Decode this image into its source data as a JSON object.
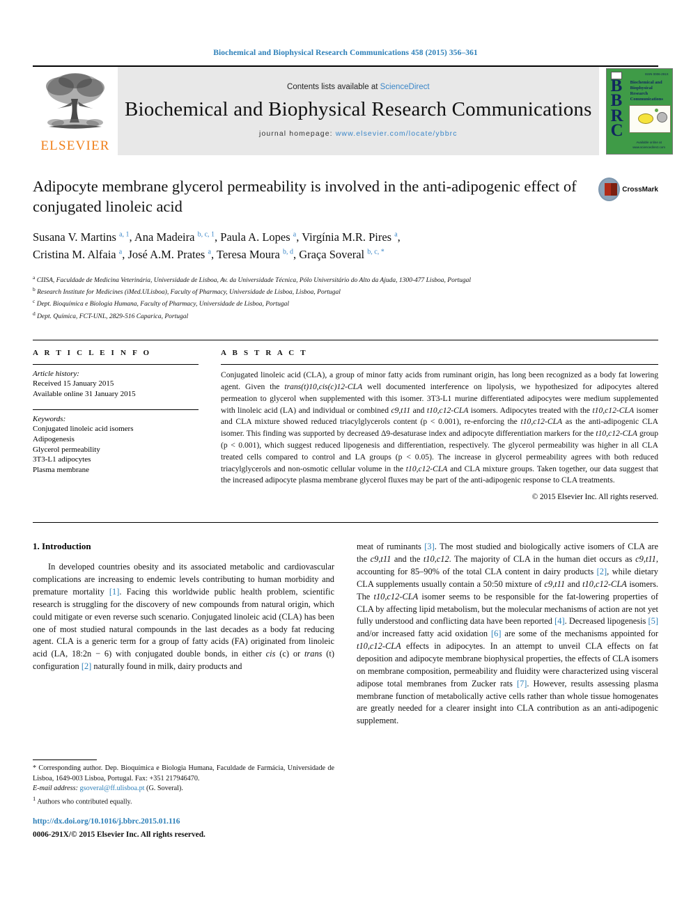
{
  "running_head": "Biochemical and Biophysical Research Communications 458 (2015) 356–361",
  "masthead": {
    "publisher": "ELSEVIER",
    "contents_prefix": "Contents lists available at ",
    "contents_link": "ScienceDirect",
    "journal_title": "Biochemical and Biophysical Research Communications",
    "homepage_label": "journal homepage: ",
    "homepage_url": "www.elsevier.com/locate/ybbrc",
    "cover": {
      "letters": "BBRC",
      "title_lines": "Biochemical and Biophysical Research Communications",
      "top_right": "ISSN 0006-291X",
      "bottom_lines": "Available online at www.sciencedirect.com"
    },
    "colors": {
      "link": "#3a86c8",
      "band": "#e8e8e8",
      "elsevier_orange": "#f07f1a",
      "cover_green": "#3f9b47"
    }
  },
  "article": {
    "title": "Adipocyte membrane glycerol permeability is involved in the anti-adipogenic effect of conjugated linoleic acid",
    "crossmark_label": "CrossMark",
    "authors_line1_parts": [
      {
        "name": "Susana V. Martins",
        "sup": "a, 1"
      },
      {
        "name": "Ana Madeira",
        "sup": "b, c, 1"
      },
      {
        "name": "Paula A. Lopes",
        "sup": "a"
      },
      {
        "name": "Virgínia M.R. Pires",
        "sup": "a"
      }
    ],
    "authors_line2_parts": [
      {
        "name": "Cristina M. Alfaia",
        "sup": "a"
      },
      {
        "name": "José A.M. Prates",
        "sup": "a"
      },
      {
        "name": "Teresa Moura",
        "sup": "b, d"
      },
      {
        "name": "Graça Soveral",
        "sup": "b, c, *"
      }
    ],
    "affiliations": [
      {
        "marker": "a",
        "text": "CIISA, Faculdade de Medicina Veterinária, Universidade de Lisboa, Av. da Universidade Técnica, Pólo Universitário do Alto da Ajuda, 1300-477 Lisboa, Portugal"
      },
      {
        "marker": "b",
        "text": "Research Institute for Medicines (iMed.ULisboa), Faculty of Pharmacy, Universidade de Lisboa, Lisboa, Portugal"
      },
      {
        "marker": "c",
        "text": "Dept. Bioquímica e Biologia Humana, Faculty of Pharmacy, Universidade de Lisboa, Portugal"
      },
      {
        "marker": "d",
        "text": "Dept. Química, FCT-UNL, 2829-516 Caparica, Portugal"
      }
    ]
  },
  "article_info": {
    "heading": "A R T I C L E   I N F O",
    "history_label": "Article history:",
    "history": [
      "Received 15 January 2015",
      "Available online 31 January 2015"
    ],
    "keywords_label": "Keywords:",
    "keywords": [
      "Conjugated linoleic acid isomers",
      "Adipogenesis",
      "Glycerol permeability",
      "3T3-L1 adipocytes",
      "Plasma membrane"
    ]
  },
  "abstract": {
    "heading": "A B S T R A C T",
    "text": "Conjugated linoleic acid (CLA), a group of minor fatty acids from ruminant origin, has long been recognized as a body fat lowering agent. Given the trans(t)10,cis(c)12-CLA well documented interference on lipolysis, we hypothesized for adipocytes altered permeation to glycerol when supplemented with this isomer. 3T3-L1 murine differentiated adipocytes were medium supplemented with linoleic acid (LA) and individual or combined c9,t11 and t10,c12-CLA isomers. Adipocytes treated with the t10,c12-CLA isomer and CLA mixture showed reduced triacylglycerols content (p < 0.001), re-enforcing the t10,c12-CLA as the anti-adipogenic CLA isomer. This finding was supported by decreased Δ9-desaturase index and adipocyte differentiation markers for the t10,c12-CLA group (p < 0.001), which suggest reduced lipogenesis and differentiation, respectively. The glycerol permeability was higher in all CLA treated cells compared to control and LA groups (p < 0.05). The increase in glycerol permeability agrees with both reduced triacylglycerols and non-osmotic cellular volume in the t10,c12-CLA and CLA mixture groups. Taken together, our data suggest that the increased adipocyte plasma membrane glycerol fluxes may be part of the anti-adipogenic response to CLA treatments.",
    "copyright": "© 2015 Elsevier Inc. All rights reserved."
  },
  "body": {
    "section_heading": "1. Introduction",
    "left_paragraph": "In developed countries obesity and its associated metabolic and cardiovascular complications are increasing to endemic levels contributing to human morbidity and premature mortality [1]. Facing this worldwide public health problem, scientific research is struggling for the discovery of new compounds from natural origin, which could mitigate or even reverse such scenario. Conjugated linoleic acid (CLA) has been one of most studied natural compounds in the last decades as a body fat reducing agent. CLA is a generic term for a group of fatty acids (FA) originated from linoleic acid (LA, 18:2n − 6) with conjugated double bonds, in either cis (c) or trans (t) configuration [2] naturally found in milk, dairy products and",
    "right_paragraph": "meat of ruminants [3]. The most studied and biologically active isomers of CLA are the c9,t11 and the t10,c12. The majority of CLA in the human diet occurs as c9,t11, accounting for 85–90% of the total CLA content in dairy products [2], while dietary CLA supplements usually contain a 50:50 mixture of c9,t11 and t10,c12-CLA isomers. The t10,c12-CLA isomer seems to be responsible for the fat-lowering properties of CLA by affecting lipid metabolism, but the molecular mechanisms of action are not yet fully understood and conflicting data have been reported [4]. Decreased lipogenesis [5] and/or increased fatty acid oxidation [6] are some of the mechanisms appointed for t10,c12-CLA effects in adipocytes. In an attempt to unveil CLA effects on fat deposition and adipocyte membrane biophysical properties, the effects of CLA isomers on membrane composition, permeability and fluidity were characterized using visceral adipose total membranes from Zucker rats [7]. However, results assessing plasma membrane function of metabolically active cells rather than whole tissue homogenates are greatly needed for a clearer insight into CLA contribution as an anti-adipogenic supplement."
  },
  "footnotes": {
    "corresponding": "* Corresponding author. Dep. Bioquímica e Biologia Humana, Faculdade de Farmácia, Universidade de Lisboa, 1649-003 Lisboa, Portugal. Fax: +351 217946470.",
    "email_label": "E-mail address: ",
    "email": "gsoveral@ff.ulisboa.pt",
    "email_suffix": " (G. Soveral).",
    "equal_contrib_marker": "1",
    "equal_contrib": "Authors who contributed equally.",
    "doi": "http://dx.doi.org/10.1016/j.bbrc.2015.01.116",
    "issn_line": "0006-291X/© 2015 Elsevier Inc. All rights reserved."
  }
}
